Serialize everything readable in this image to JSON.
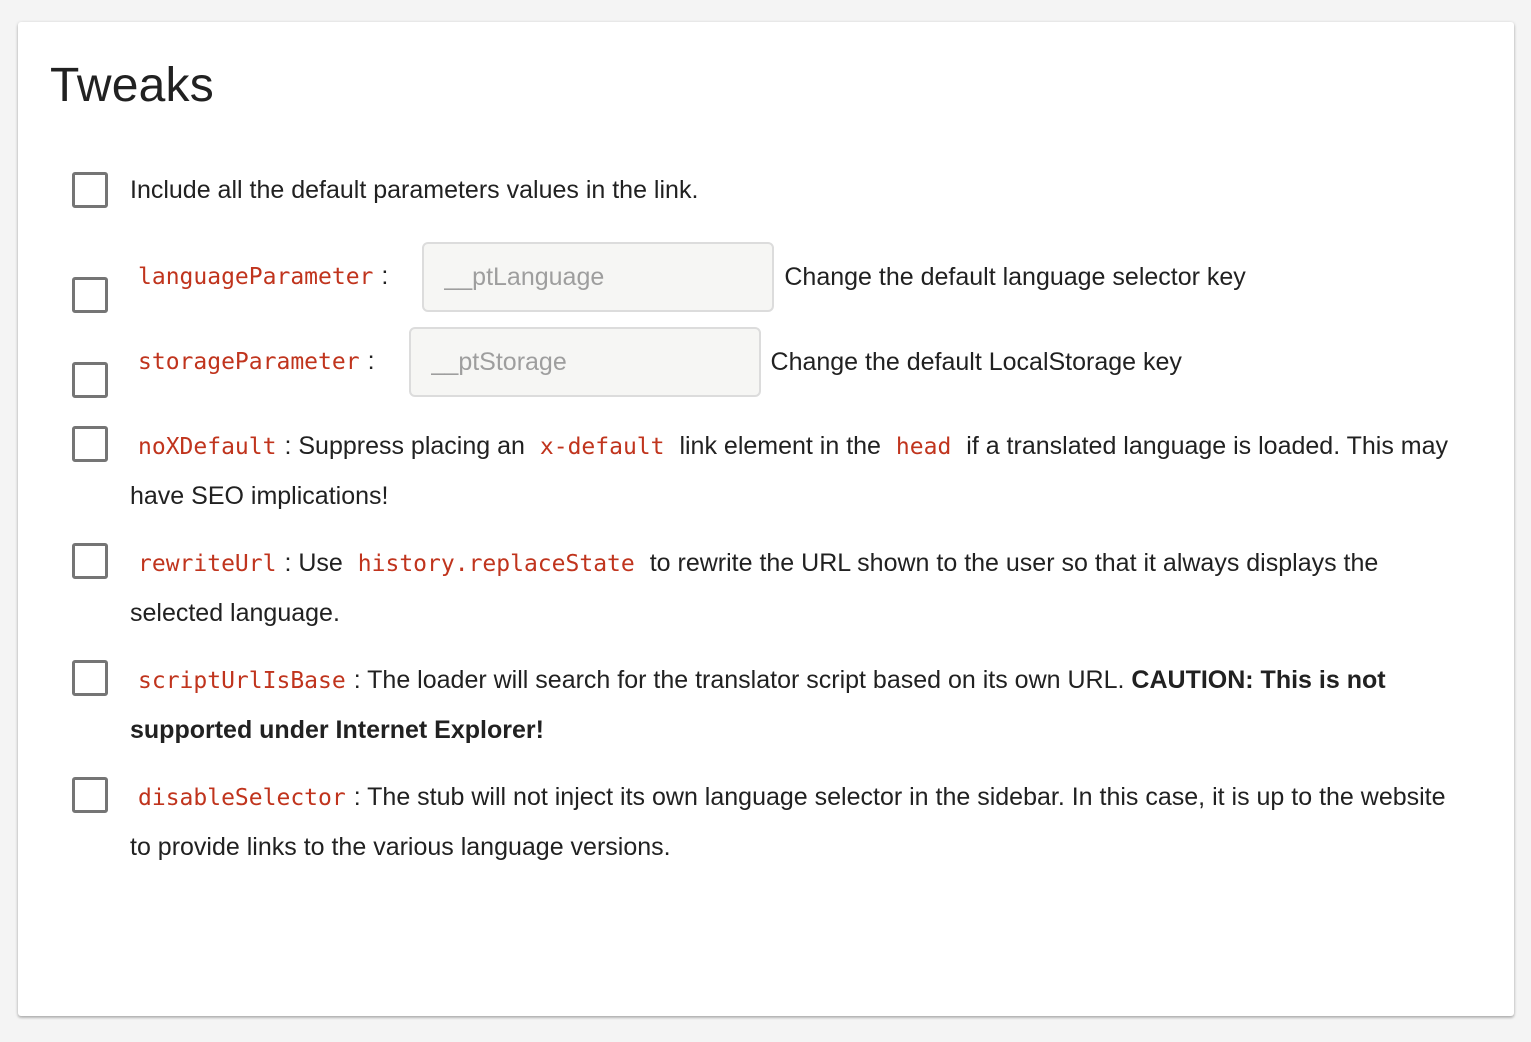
{
  "title": "Tweaks",
  "options": {
    "include_defaults": {
      "label": "Include all the default parameters values in the link."
    },
    "language_parameter": {
      "code": "languageParameter",
      "colon": ":",
      "placeholder": "__ptLanguage",
      "value": "",
      "description": "Change the default language selector key"
    },
    "storage_parameter": {
      "code": "storageParameter",
      "colon": ":",
      "placeholder": "__ptStorage",
      "value": "",
      "description": "Change the default LocalStorage key"
    },
    "no_x_default": {
      "code": "noXDefault",
      "text1": ": Suppress placing an",
      "code2": "x-default",
      "text2": "link element in the",
      "code3": "head",
      "text3": "if a translated language is loaded. This may have SEO implications!"
    },
    "rewrite_url": {
      "code": "rewriteUrl",
      "text1": ": Use",
      "code2": "history.replaceState",
      "text2": "to rewrite the URL shown to the user so that it always displays the selected language."
    },
    "script_url_is_base": {
      "code": "scriptUrlIsBase",
      "text1": ": The loader will search for the translator script based on its own URL.",
      "caution": "CAUTION: This is not supported under Internet Explorer!"
    },
    "disable_selector": {
      "code": "disableSelector",
      "text1": ": The stub will not inject its own language selector in the sidebar. In this case, it is up to the website to provide links to the various language versions."
    }
  },
  "colors": {
    "code": "#c0341d",
    "text": "#212121",
    "checkbox_border": "#757575",
    "input_bg": "#f6f6f4"
  }
}
